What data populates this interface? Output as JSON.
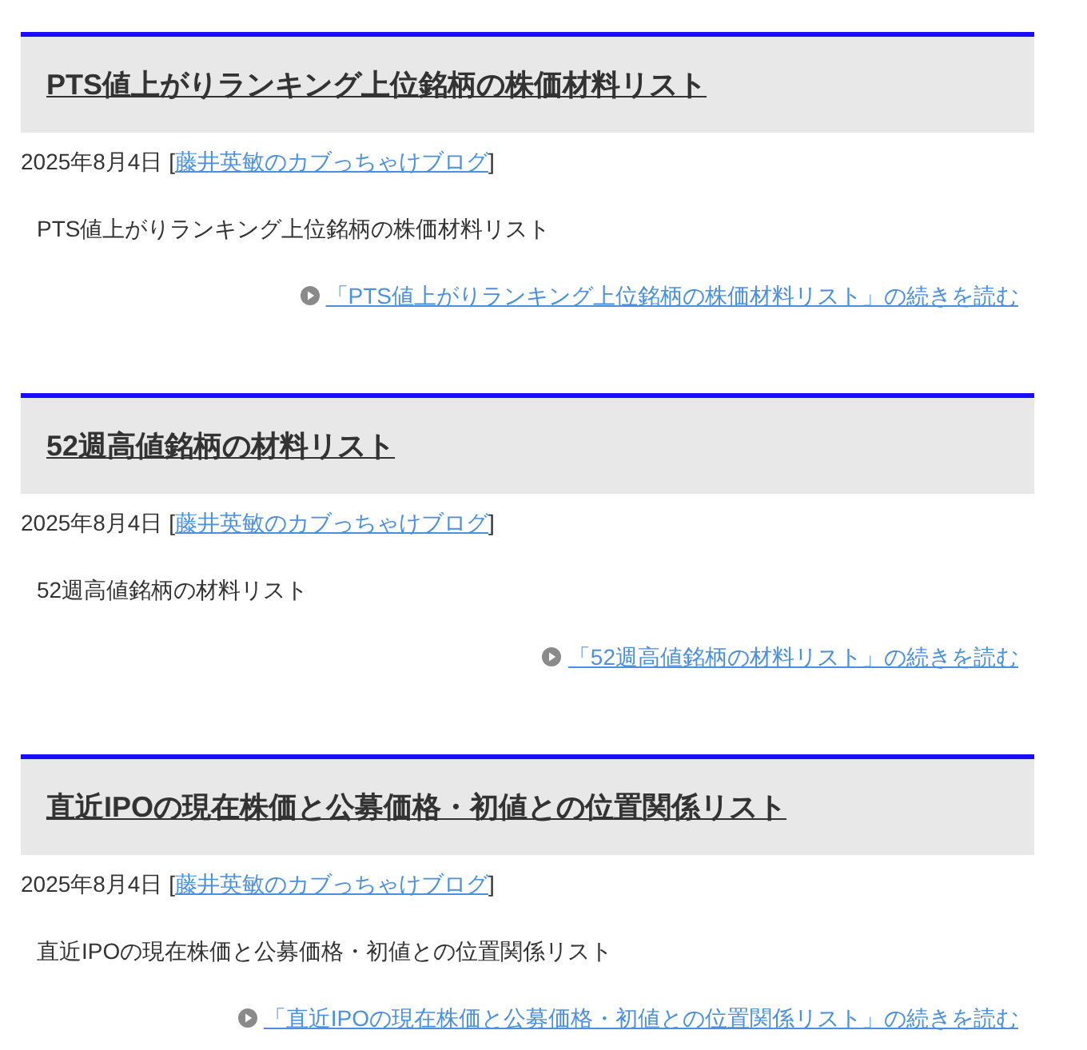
{
  "posts": [
    {
      "title": "PTS値上がりランキング上位銘柄の株価材料リスト",
      "date": "2025年8月4日",
      "source_open": "[",
      "source": "藤井英敏のカブっちゃけブログ",
      "source_close": "]",
      "summary": "PTS値上がりランキング上位銘柄の株価材料リスト",
      "more": "「PTS値上がりランキング上位銘柄の株価材料リスト」の続きを読む"
    },
    {
      "title": "52週高値銘柄の材料リスト",
      "date": "2025年8月4日",
      "source_open": "[",
      "source": "藤井英敏のカブっちゃけブログ",
      "source_close": "]",
      "summary": "52週高値銘柄の材料リスト",
      "more": "「52週高値銘柄の材料リスト」の続きを読む"
    },
    {
      "title": "直近IPOの現在株価と公募価格・初値との位置関係リスト",
      "date": "2025年8月4日",
      "source_open": "[",
      "source": "藤井英敏のカブっちゃけブログ",
      "source_close": "]",
      "summary": "直近IPOの現在株価と公募価格・初値との位置関係リスト",
      "more": "「直近IPOの現在株価と公募価格・初値との位置関係リスト」の続きを読む"
    }
  ]
}
